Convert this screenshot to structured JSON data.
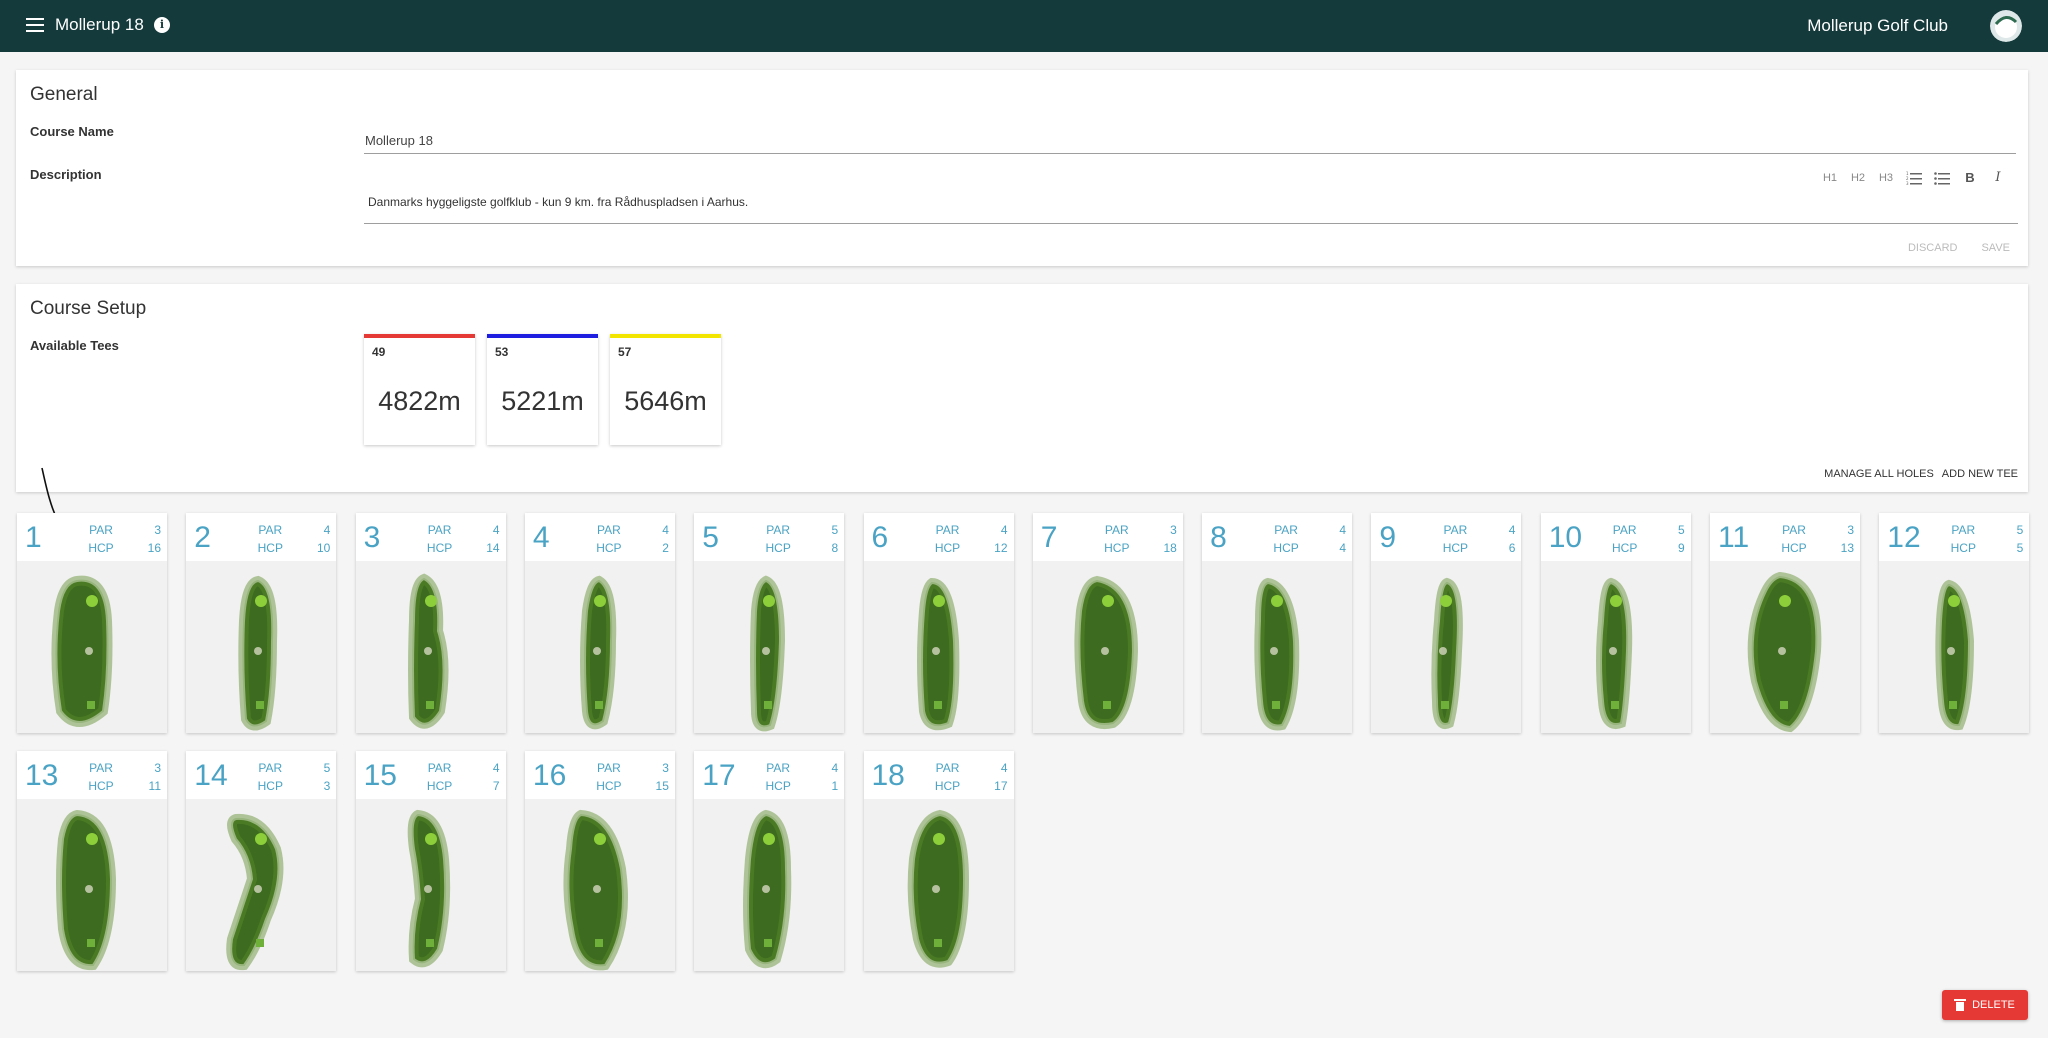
{
  "header": {
    "title": "Mollerup 18",
    "club_name": "Mollerup Golf Club",
    "menu_icon": "menu-icon",
    "info_icon": "info-icon",
    "bg_color": "#143a3b"
  },
  "general": {
    "section_title": "General",
    "course_name_label": "Course Name",
    "course_name_value": "Mollerup 18",
    "description_label": "Description",
    "description_value": "Danmarks hyggeligste golfklub - kun 9 km. fra Rådhuspladsen i Aarhus.",
    "toolbar": {
      "h1": "H1",
      "h2": "H2",
      "h3": "H3",
      "bold": "B",
      "italic": "I"
    },
    "discard_label": "DISCARD",
    "save_label": "SAVE"
  },
  "setup": {
    "section_title": "Course Setup",
    "tees_label": "Available Tees",
    "tees": [
      {
        "number": "49",
        "length": "4822m",
        "color": "#e53935"
      },
      {
        "number": "53",
        "length": "5221m",
        "color": "#1e1ee0"
      },
      {
        "number": "57",
        "length": "5646m",
        "color": "#f2e600"
      }
    ],
    "manage_label": "MANAGE ALL HOLES",
    "add_tee_label": "ADD NEW TEE"
  },
  "holes": [
    {
      "number": "1",
      "par": "3",
      "hcp": "16"
    },
    {
      "number": "2",
      "par": "4",
      "hcp": "10"
    },
    {
      "number": "3",
      "par": "4",
      "hcp": "14"
    },
    {
      "number": "4",
      "par": "4",
      "hcp": "2"
    },
    {
      "number": "5",
      "par": "5",
      "hcp": "8"
    },
    {
      "number": "6",
      "par": "4",
      "hcp": "12"
    },
    {
      "number": "7",
      "par": "3",
      "hcp": "18"
    },
    {
      "number": "8",
      "par": "4",
      "hcp": "4"
    },
    {
      "number": "9",
      "par": "4",
      "hcp": "6"
    },
    {
      "number": "10",
      "par": "5",
      "hcp": "9"
    },
    {
      "number": "11",
      "par": "3",
      "hcp": "13"
    },
    {
      "number": "12",
      "par": "5",
      "hcp": "5"
    },
    {
      "number": "13",
      "par": "3",
      "hcp": "11"
    },
    {
      "number": "14",
      "par": "5",
      "hcp": "3"
    },
    {
      "number": "15",
      "par": "4",
      "hcp": "7"
    },
    {
      "number": "16",
      "par": "3",
      "hcp": "15"
    },
    {
      "number": "17",
      "par": "4",
      "hcp": "1"
    },
    {
      "number": "18",
      "par": "4",
      "hcp": "17"
    }
  ],
  "hole_labels": {
    "par": "PAR",
    "hcp": "HCP"
  },
  "delete_label": "DELETE"
}
